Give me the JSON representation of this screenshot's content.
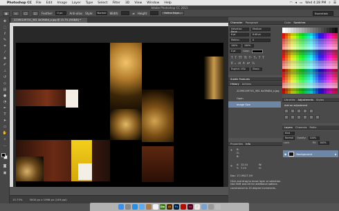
{
  "menubar": {
    "app": "Photoshop CC",
    "items": [
      "File",
      "Edit",
      "Image",
      "Layer",
      "Type",
      "Select",
      "Filter",
      "3D",
      "View",
      "Window",
      "Help"
    ],
    "clock": "Wed 4:28 PM"
  },
  "window": {
    "title": "Adobe Photoshop CC 2015"
  },
  "options_bar": {
    "feather_label": "Feather:",
    "feather_value": "0 px",
    "antialias_label": "Anti-alias",
    "style_label": "Style:",
    "style_value": "Normal",
    "width_label": "Width:",
    "height_label": "Height:",
    "refine_label": "Refine Edge...",
    "workspace": "Essentials"
  },
  "document": {
    "tab_label": "22390109701_561 4a3948d_o.jpg @ 15.7% (RGB/8) *",
    "zoom": "15.73%",
    "doc_size": "3000 px x 1998 px (149 ppi)"
  },
  "panels": {
    "character_tabs": [
      "Character",
      "Paragraph"
    ],
    "character": {
      "font_family": "Helvetica Neue",
      "font_style": "Medium",
      "size": "6 pt",
      "leading": "8.08 pt",
      "tracking": "0",
      "kerning": "Metrics",
      "vscale": "100%",
      "hscale": "100%",
      "baseline": "0 pt",
      "color_label": "Color:",
      "language": "English: USA",
      "antialias": "Sharp"
    },
    "style_tabs": [
      "Subtle Features"
    ],
    "history_tabs": [
      "History",
      "Actions"
    ],
    "history": {
      "snapshot": "22390109701_561 4a3948d_o.jpg",
      "items": [
        "Open",
        "Image Size"
      ]
    },
    "properties_tabs": [
      "Properties",
      "Info"
    ],
    "info": {
      "r": "R:",
      "g": "G:",
      "b": "B:",
      "x": "X:",
      "y": "Y:",
      "w": "W:",
      "h": "H:",
      "x_val": "12.14",
      "y_val": "7.13",
      "doc_line": "Doc: 17.1M/17.1M",
      "hint": "Click and drag to move layer or selection. Use Shift and Alt for additional options.",
      "hint2": "constrained to 45 degree increments."
    },
    "swatch_tabs": [
      "Color",
      "Swatches"
    ],
    "libraries_tabs": [
      "Libraries",
      "Adjustments",
      "Styles"
    ],
    "adjust_label": "Add an adjustment",
    "layers_tabs": [
      "Layers",
      "Channels",
      "Paths"
    ],
    "layers": {
      "kind": "Kind",
      "blend": "Normal",
      "opacity_label": "Opacity:",
      "opacity": "100%",
      "lock_label": "Lock:",
      "fill_label": "Fill:",
      "fill": "100%",
      "items": [
        "Background"
      ]
    }
  },
  "dock": [
    "Finder",
    "Launchpad",
    "Safari",
    "Mail",
    "Contacts",
    "Calendar",
    "Dreamweaver",
    "Illustrator",
    "Photoshop",
    "Acrobat",
    "InDesign",
    "Music",
    "Preview",
    "Settings",
    "Trash"
  ]
}
